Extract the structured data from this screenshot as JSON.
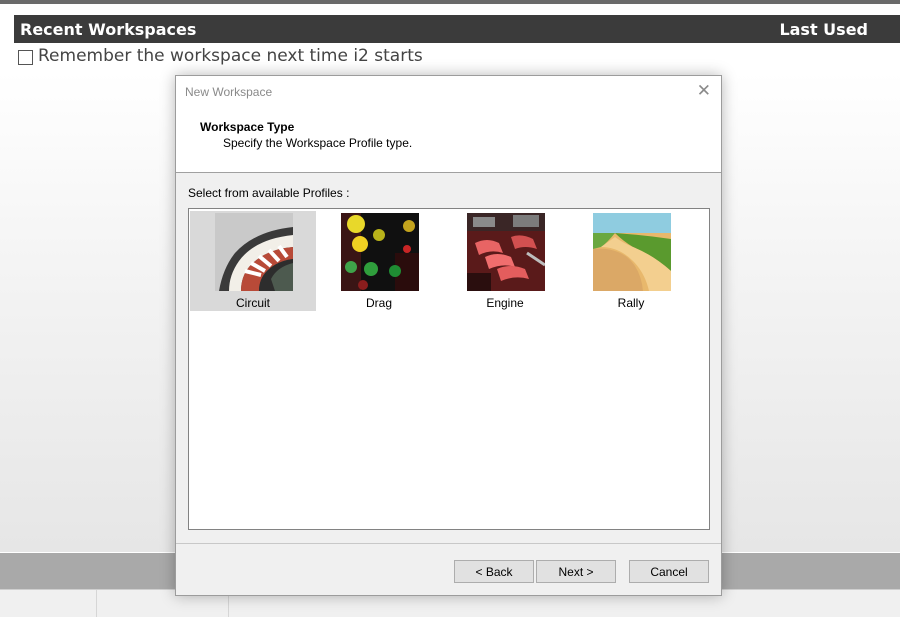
{
  "background": {
    "header_title": "Recent Workspaces",
    "header_last_used": "Last Used",
    "remember_label": "Remember the workspace next time i2 starts",
    "remember_checked": false
  },
  "dialog": {
    "title": "New Workspace",
    "close_icon": "close-icon",
    "header": {
      "heading": "Workspace Type",
      "subheading": "Specify the Workspace Profile type."
    },
    "profiles_label": "Select from available Profiles :",
    "profiles": [
      {
        "label": "Circuit",
        "selected": true,
        "icon": "circuit-track-image"
      },
      {
        "label": "Drag",
        "selected": false,
        "icon": "drag-lights-image"
      },
      {
        "label": "Engine",
        "selected": false,
        "icon": "engine-image"
      },
      {
        "label": "Rally",
        "selected": false,
        "icon": "rally-road-image"
      }
    ],
    "buttons": {
      "back": "< Back",
      "next": "Next >",
      "cancel": "Cancel"
    }
  }
}
